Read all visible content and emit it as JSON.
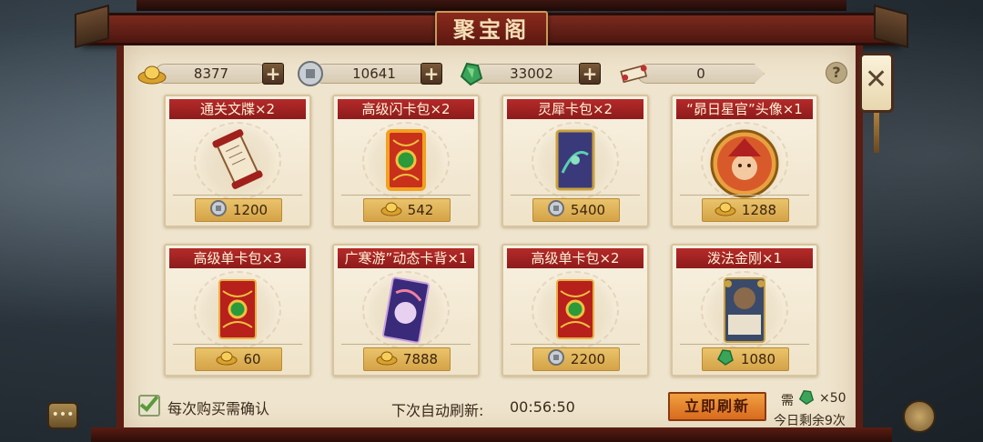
{
  "title": "聚宝阁",
  "currencies": [
    {
      "icon": "gold-ingot-icon",
      "value": "8377",
      "has_plus": true
    },
    {
      "icon": "silver-coin-icon",
      "value": "10641",
      "has_plus": true
    },
    {
      "icon": "jade-icon",
      "value": "33002",
      "has_plus": true
    },
    {
      "icon": "scroll-ticket-icon",
      "value": "0",
      "has_plus": false
    }
  ],
  "help_label": "?",
  "cards": [
    {
      "title": "通关文牒×2",
      "art": "scroll",
      "price_icon": "silver-coin-icon",
      "price": "1200"
    },
    {
      "title": "高级闪卡包×2",
      "art": "flash-pack",
      "price_icon": "gold-ingot-icon",
      "price": "542"
    },
    {
      "title": "灵犀卡包×2",
      "art": "blue-pack",
      "price_icon": "silver-coin-icon",
      "price": "5400"
    },
    {
      "title": "“昴日星官”头像×1",
      "art": "portrait",
      "price_icon": "gold-ingot-icon",
      "price": "1288"
    },
    {
      "title": "高级单卡包×3",
      "art": "red-pack",
      "price_icon": "gold-ingot-icon",
      "price": "60"
    },
    {
      "title": "广寒游”动态卡背×1",
      "art": "card-back",
      "price_icon": "gold-ingot-icon",
      "price": "7888"
    },
    {
      "title": "高级单卡包×2",
      "art": "red-pack",
      "price_icon": "silver-coin-icon",
      "price": "2200"
    },
    {
      "title": "泼法金刚×1",
      "art": "hero-card",
      "price_icon": "jade-icon",
      "price": "1080"
    }
  ],
  "footer": {
    "confirm_label": "每次购买需确认",
    "refresh_label": "下次自动刷新:",
    "refresh_time": "00:56:50",
    "refresh_button": "立即刷新",
    "need_label": "需",
    "need_count": "×50",
    "remain_label": "今日剩余9次"
  },
  "colors": {
    "accent_red": "#b52a2a",
    "price_gold": "#e9c36c",
    "refresh_orange": "#e8862e"
  }
}
